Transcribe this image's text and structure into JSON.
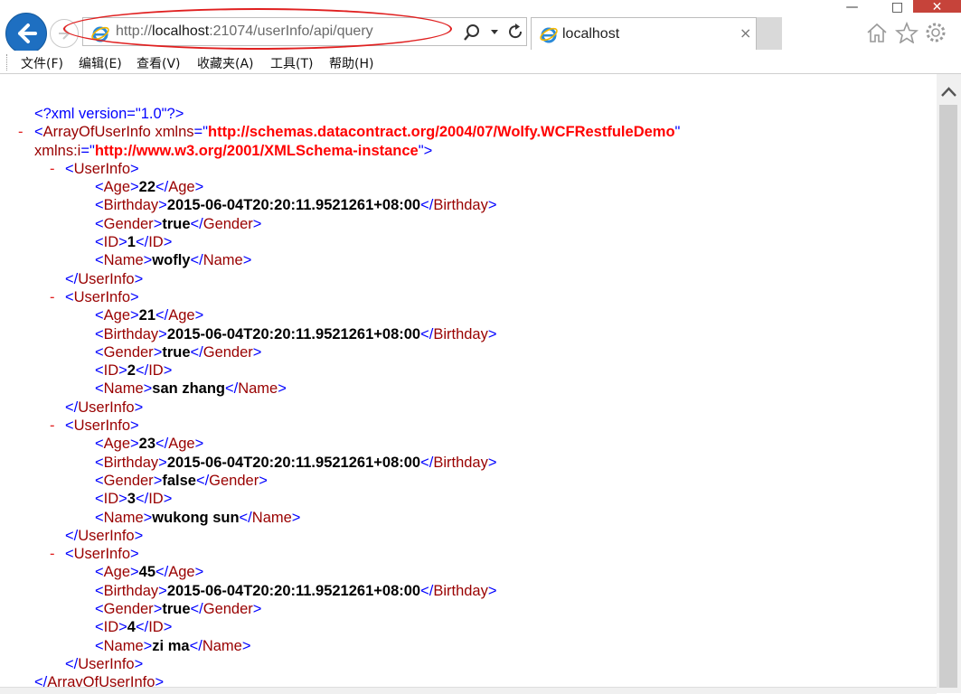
{
  "browser": {
    "url_prefix": "http://",
    "url_host": "localhost",
    "url_rest": ":21074/userInfo/api/query",
    "tab_title": "localhost",
    "tab_close": "×",
    "win_min": "—",
    "win_max": "□",
    "win_close": "✕",
    "accent_color": "#1e6fc1",
    "highlight_color": "#e02020"
  },
  "menu": [
    {
      "label": "文件(F)"
    },
    {
      "label": "编辑(E)"
    },
    {
      "label": "查看(V)"
    },
    {
      "label": "收藏夹(A)"
    },
    {
      "label": "工具(T)"
    },
    {
      "label": "帮助(H)"
    }
  ],
  "xml": {
    "declaration": "<?xml version=\"1.0\"?>",
    "collapse_marker": "-",
    "root_name": "ArrayOfUserInfo",
    "attr1_name": "xmlns",
    "attr1_value": "http://schemas.datacontract.org/2004/07/Wolfy.WCFRestfuleDemo",
    "attr2_name": "xmlns:i",
    "attr2_value": "http://www.w3.org/2001/XMLSchema-instance",
    "item_name": "UserInfo",
    "fields": [
      "Age",
      "Birthday",
      "Gender",
      "ID",
      "Name"
    ],
    "users": [
      {
        "Age": "22",
        "Birthday": "2015-06-04T20:20:11.9521261+08:00",
        "Gender": "true",
        "ID": "1",
        "Name": "wofly"
      },
      {
        "Age": "21",
        "Birthday": "2015-06-04T20:20:11.9521261+08:00",
        "Gender": "true",
        "ID": "2",
        "Name": "san zhang"
      },
      {
        "Age": "23",
        "Birthday": "2015-06-04T20:20:11.9521261+08:00",
        "Gender": "false",
        "ID": "3",
        "Name": "wukong sun"
      },
      {
        "Age": "45",
        "Birthday": "2015-06-04T20:20:11.9521261+08:00",
        "Gender": "true",
        "ID": "4",
        "Name": "zi ma"
      }
    ]
  }
}
